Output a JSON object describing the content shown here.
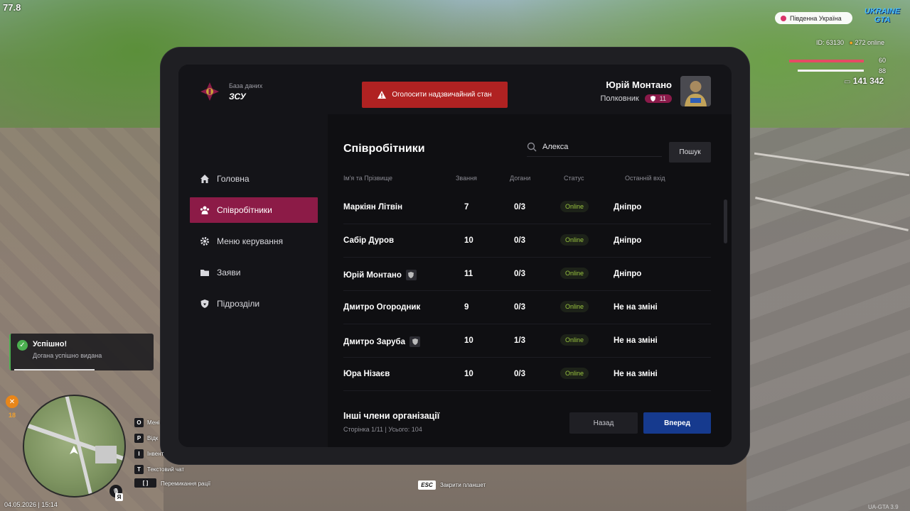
{
  "hud": {
    "fps": "77.8",
    "region": "Південна Україна",
    "logo": "UKRAINE GTA",
    "player_id": "ID: 63130",
    "online": "272 online",
    "health": "60",
    "armor": "88",
    "money": "141 342",
    "food": "18",
    "datetime": "04.05.2026 | 15:14",
    "version": "UA-GTA 3.9",
    "esc_key": "ESC",
    "esc_label": "Закрити планшет",
    "hints": [
      {
        "key": "O",
        "label": "Мені"
      },
      {
        "key": "P",
        "label": "Відк"
      },
      {
        "key": "I",
        "label": "Інвент"
      },
      {
        "key": "T",
        "label": "Текстовий чат"
      },
      {
        "key": "[ ]",
        "label": "Перемикання рації"
      }
    ],
    "mic_key": "Я"
  },
  "notification": {
    "title": "Успішно!",
    "message": "Догана успішно видана",
    "color": "#4caf50"
  },
  "header": {
    "brand_sub": "База даних",
    "brand_title": "ЗСУ",
    "emergency_button": "Оголосити надзвичайний стан",
    "user_name": "Юрій Монтано",
    "user_rank": "Полковник",
    "rank_level": "11"
  },
  "nav": {
    "items": [
      {
        "label": "Головна",
        "icon": "home-icon"
      },
      {
        "label": "Співробітники",
        "icon": "users-icon",
        "active": true
      },
      {
        "label": "Меню керування",
        "icon": "gear-icon"
      },
      {
        "label": "Заяви",
        "icon": "folder-icon"
      },
      {
        "label": "Підрозділи",
        "icon": "shield-icon"
      }
    ]
  },
  "main": {
    "title": "Співробітники",
    "search_value": "Алекса",
    "search_button": "Пошук",
    "columns": [
      "Ім'я та Прізвище",
      "Звання",
      "Догани",
      "Статус",
      "Останній вхід"
    ],
    "rows": [
      {
        "name": "Маркіян Літвін",
        "rank": "7",
        "reprimands": "0/3",
        "status": "Online",
        "last": "Дніпро",
        "badge": false
      },
      {
        "name": "Сабір Дуров",
        "rank": "10",
        "reprimands": "0/3",
        "status": "Online",
        "last": "Дніпро",
        "badge": false
      },
      {
        "name": "Юрій Монтано",
        "rank": "11",
        "reprimands": "0/3",
        "status": "Online",
        "last": "Дніпро",
        "badge": true
      },
      {
        "name": "Дмитро Огородник",
        "rank": "9",
        "reprimands": "0/3",
        "status": "Online",
        "last": "Не на зміні",
        "badge": false
      },
      {
        "name": "Дмитро Заруба",
        "rank": "10",
        "reprimands": "1/3",
        "status": "Online",
        "last": "Не на зміні",
        "badge": true
      },
      {
        "name": "Юра Нізаєв",
        "rank": "10",
        "reprimands": "0/3",
        "status": "Online",
        "last": "Не на зміні",
        "badge": false
      }
    ],
    "others_title": "Інші члени організації",
    "others_sub": "Сторінка 1/11 | Усього: 104",
    "back_button": "Назад",
    "next_button": "Вперед"
  },
  "colors": {
    "accent": "#8c1b47",
    "emergency": "#b02222",
    "next": "#163a8e",
    "online": "#9ac53f"
  }
}
